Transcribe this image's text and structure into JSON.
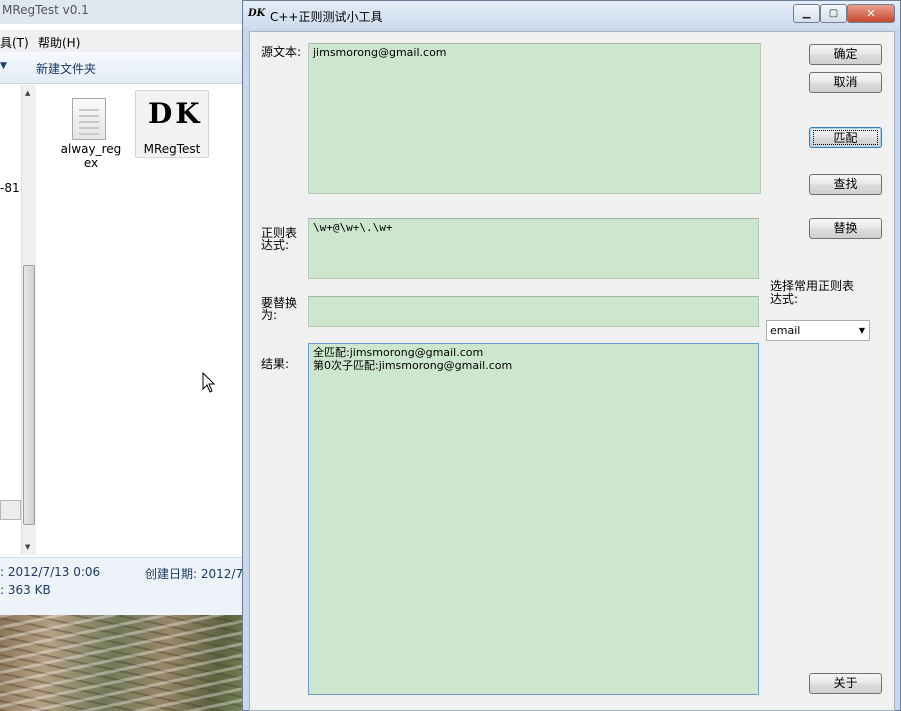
{
  "explorer": {
    "title": "MRegTest v0.1",
    "menu_tools": "具(T)",
    "menu_help": "帮助(H)",
    "toolbar_new_folder": "新建文件夹",
    "nav_fragment": "-81",
    "files": [
      {
        "name": "alway_reg\nex"
      },
      {
        "name": "MRegTest"
      }
    ],
    "details": {
      "modified": ": 2012/7/13 0:06",
      "created_label": "创建日期: 2012/7",
      "size": ": 363 KB"
    }
  },
  "dialog": {
    "title": "C++正则测试小工具",
    "icon_text": "DK",
    "source_label": "源文本:",
    "source_text": "jimsmorong@gmail.com",
    "regex_label": "正则表\n达式:",
    "regex_text": "\\w+@\\w+\\.\\w+",
    "replace_label": "要替换\n为:",
    "replace_text": "",
    "result_label": "结果:",
    "result_text": "全匹配:jimsmorong@gmail.com\n第0次子匹配:jimsmorong@gmail.com",
    "common_label": "选择常用正则表\n达式:",
    "common_selected": "email",
    "buttons": {
      "ok": "确定",
      "cancel": "取消",
      "match": "匹配",
      "find": "查找",
      "replace": "替换",
      "about": "关于"
    }
  },
  "colors": {
    "textbox_bg": "#cde7cf",
    "titlebar": "#ccdbed",
    "close_button": "#c8472e"
  }
}
